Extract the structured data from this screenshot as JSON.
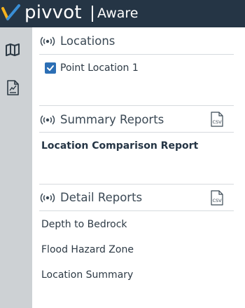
{
  "header": {
    "brand_name": "pivvot",
    "product_name": "Aware",
    "logo_colors": [
      "#f5b21c",
      "#3a8fd6"
    ],
    "background": "#253545"
  },
  "sidebar": {
    "buttons": [
      {
        "icon": "map-icon"
      },
      {
        "icon": "report-icon"
      }
    ]
  },
  "sections": {
    "locations": {
      "title": "Locations",
      "items": [
        {
          "label": "Point Location 1",
          "checked": true
        }
      ]
    },
    "summary_reports": {
      "title": "Summary Reports",
      "csv_label": "CSV",
      "items": [
        {
          "label": "Location Comparison Report"
        }
      ]
    },
    "detail_reports": {
      "title": "Detail Reports",
      "csv_label": "CSV",
      "items": [
        {
          "label": "Depth to Bedrock"
        },
        {
          "label": "Flood Hazard Zone"
        },
        {
          "label": "Location Summary"
        }
      ]
    }
  }
}
